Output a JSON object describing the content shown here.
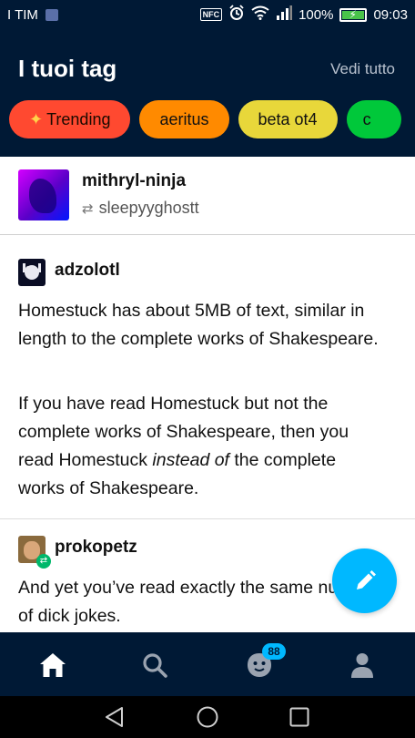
{
  "status_bar": {
    "carrier": "I TIM",
    "battery_percent": "100%",
    "time": "09:03",
    "nfc_label": "NFC",
    "icons": [
      "notification-icon",
      "nfc-icon",
      "alarm-icon",
      "wifi-icon",
      "signal-icon",
      "battery-icon"
    ]
  },
  "header": {
    "title": "I tuoi tag",
    "see_all": "Vedi tutto"
  },
  "tags": [
    {
      "label": "Trending",
      "color": "#ff4930",
      "icon": "sparkle-icon"
    },
    {
      "label": "aeritus",
      "color": "#ff8a00"
    },
    {
      "label": "beta ot4",
      "color": "#e8d73a"
    },
    {
      "label": "c",
      "color": "#00c83a"
    }
  ],
  "post": {
    "author": "mithryl-ninja",
    "reblogged_from": "sleepyyghostt",
    "reblogs": [
      {
        "blog": "adzolotl",
        "paragraphs": [
          "Homestuck has about 5MB of text, similar in length to the complete works of Shakespeare.",
          "If you have read Homestuck but not the complete works of Shakespeare, then you read Homestuck",
          "instead of",
          "the complete works of Shakespeare."
        ]
      },
      {
        "blog": "prokopetz",
        "paragraphs": [
          "And yet you’ve read exactly the same number of dick jokes."
        ]
      }
    ]
  },
  "bottom_nav": {
    "items": [
      "home-icon",
      "search-icon",
      "activity-icon",
      "account-icon"
    ],
    "activity_badge": "88"
  },
  "colors": {
    "background": "#001935",
    "accent": "#00b8ff",
    "feed": "#ffffff"
  }
}
